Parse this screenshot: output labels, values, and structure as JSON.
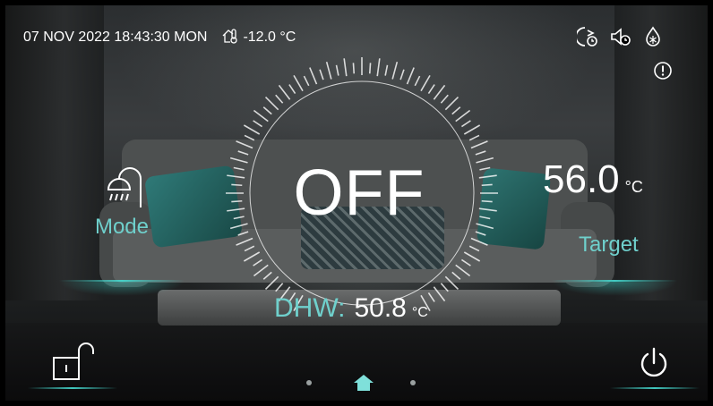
{
  "status_bar": {
    "datetime": "07  NOV  2022 18:43:30  MON",
    "outdoor_temp": "-12.0 °C",
    "outdoor_icon": "outdoor-thermometer-icon"
  },
  "top_right_icons": [
    "timer-schedule-icon",
    "silent-timer-icon",
    "frost-protection-icon",
    "alarm-icon"
  ],
  "dial": {
    "power_state": "OFF",
    "dhw_label": "DHW:",
    "dhw_value": "50.8",
    "dhw_unit": "°C"
  },
  "mode": {
    "label": "Mode",
    "icon": "shower-icon"
  },
  "target": {
    "value": "56.0",
    "unit": "°C",
    "label": "Target"
  },
  "bottom_bar": {
    "lock_icon": "unlock-icon",
    "power_icon": "power-icon",
    "page_indicator": [
      "dot",
      "home-icon",
      "dot"
    ],
    "active_page": 2
  },
  "colors": {
    "accent": "#6fd0cc",
    "text": "#ffffff",
    "glow": "#46dcd2"
  }
}
